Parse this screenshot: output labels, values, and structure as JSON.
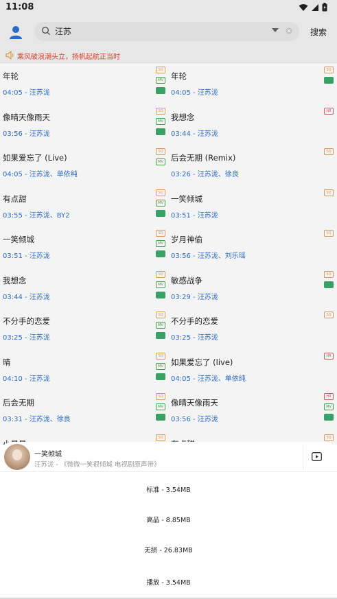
{
  "status": {
    "time": "11:08"
  },
  "header": {
    "search_value": "汪苏",
    "search_button": "搜索"
  },
  "notice": {
    "text": "乘风破浪潮头立，扬帆起航正当时"
  },
  "songs": [
    {
      "title": "年轮",
      "duration": "04:05",
      "artist": "汪苏泷",
      "badges": [
        "SQ",
        "MV",
        "GT"
      ]
    },
    {
      "title": "年轮",
      "duration": "04:05",
      "artist": "汪苏泷",
      "badges": [
        "SQ",
        "GT"
      ]
    },
    {
      "title": "像晴天像雨天",
      "duration": "03:56",
      "artist": "汪苏泷",
      "badges": [
        "SQ",
        "MV",
        "GT"
      ]
    },
    {
      "title": "我想念",
      "duration": "03:44",
      "artist": "汪苏泷",
      "badges": [
        "HR"
      ]
    },
    {
      "title": "如果爱忘了 (Live)",
      "duration": "04:05",
      "artist": "汪苏泷、单依纯",
      "badges": [
        "SQ",
        "MV"
      ]
    },
    {
      "title": "后会无期 (Remix)",
      "duration": "03:26",
      "artist": "汪苏泷、徐良",
      "badges": [
        "SQ"
      ]
    },
    {
      "title": "有点甜",
      "duration": "03:55",
      "artist": "汪苏泷、BY2",
      "badges": [
        "SQ",
        "MV",
        "GT"
      ]
    },
    {
      "title": "一笑倾城",
      "duration": "03:51",
      "artist": "汪苏泷",
      "badges": [
        "SQ"
      ]
    },
    {
      "title": "一笑倾城",
      "duration": "03:51",
      "artist": "汪苏泷",
      "badges": [
        "SQ",
        "MV",
        "GT"
      ]
    },
    {
      "title": "岁月神偷",
      "duration": "03:56",
      "artist": "汪苏泷、刘乐瑶",
      "badges": [
        "SQ"
      ]
    },
    {
      "title": "我想念",
      "duration": "03:44",
      "artist": "汪苏泷",
      "badges": [
        "SQ",
        "MV",
        "GT"
      ]
    },
    {
      "title": "敏感战争",
      "duration": "03:29",
      "artist": "汪苏泷",
      "badges": [
        "SQ",
        "GT"
      ]
    },
    {
      "title": "不分手的恋爱",
      "duration": "03:25",
      "artist": "汪苏泷",
      "badges": [
        "SQ",
        "MV",
        "GT"
      ]
    },
    {
      "title": "不分手的恋爱",
      "duration": "03:25",
      "artist": "汪苏泷",
      "badges": [
        "SQ"
      ]
    },
    {
      "title": "晴",
      "duration": "04:10",
      "artist": "汪苏泷",
      "badges": [
        "SQ",
        "MV",
        "GT"
      ]
    },
    {
      "title": "如果爱忘了 (live)",
      "duration": "04:05",
      "artist": "汪苏泷、单依纯",
      "badges": [
        "HR"
      ]
    },
    {
      "title": "后会无期",
      "duration": "03:31",
      "artist": "汪苏泷、徐良",
      "badges": [
        "SQ",
        "MV",
        "GT"
      ]
    },
    {
      "title": "像晴天像雨天",
      "duration": "03:56",
      "artist": "汪苏泷",
      "badges": [
        "HR",
        "MV",
        "GT"
      ]
    },
    {
      "title": "小星星",
      "duration": "",
      "artist": "",
      "badges": [
        "SQ"
      ]
    },
    {
      "title": "有点甜",
      "duration": "",
      "artist": "",
      "badges": [
        "SQ"
      ]
    }
  ],
  "sheet": {
    "song_title": "一笑倾城",
    "song_subtitle": "汪苏泷 - 《微微一笑很倾城 电视剧原声带》",
    "options": [
      "标准 - 3.54MB",
      "高品 - 8.85MB",
      "无损 - 26.83MB",
      "播放 - 3.54MB"
    ]
  },
  "colors": {
    "accent_blue": "#2d6fc9",
    "notice_red": "#e2462a",
    "badge_sq": "#e6a15c",
    "badge_hr": "#e05a5a",
    "badge_mv": "#47a347",
    "badge_gt": "#3da96b"
  }
}
